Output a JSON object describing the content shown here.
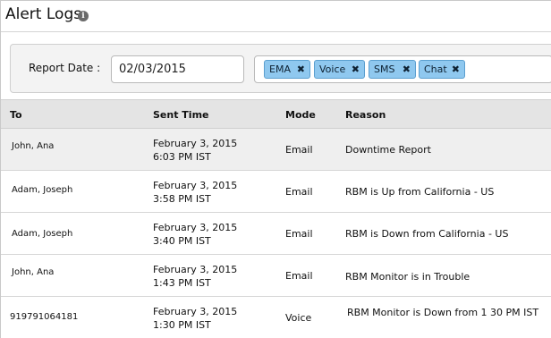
{
  "header": {
    "title": "Alert Logs",
    "info_icon": "info-icon"
  },
  "filter": {
    "report_date_label": "Report Date :",
    "report_date_value": "02/03/2015",
    "channels": [
      "EMA",
      "Voice",
      "SMS",
      "Chat"
    ],
    "remove_glyph": "✖"
  },
  "table": {
    "columns": {
      "to": "To",
      "sent_time": "Sent Time",
      "mode": "Mode",
      "reason": "Reason"
    },
    "rows": [
      {
        "to": "John, Ana",
        "date": "February 3, 2015",
        "time": "6:03 PM IST",
        "mode": "Email",
        "reason": "Downtime Report"
      },
      {
        "to": "Adam, Joseph",
        "date": "February 3, 2015",
        "time": "3:58 PM IST",
        "mode": "Email",
        "reason": "RBM is Up from California - US"
      },
      {
        "to": "Adam, Joseph",
        "date": "February 3, 2015",
        "time": "3:40 PM IST",
        "mode": "Email",
        "reason": "RBM is Down from California - US"
      },
      {
        "to": "John, Ana",
        "date": "February 3, 2015",
        "time": "1:43 PM IST",
        "mode": "Email",
        "reason": "RBM Monitor is in Trouble"
      },
      {
        "to": "919791064181",
        "date": "February 3, 2015",
        "time": "1:30 PM IST",
        "mode": "Voice",
        "reason": "RBM Monitor is Down from 1 30 PM IST"
      }
    ]
  }
}
